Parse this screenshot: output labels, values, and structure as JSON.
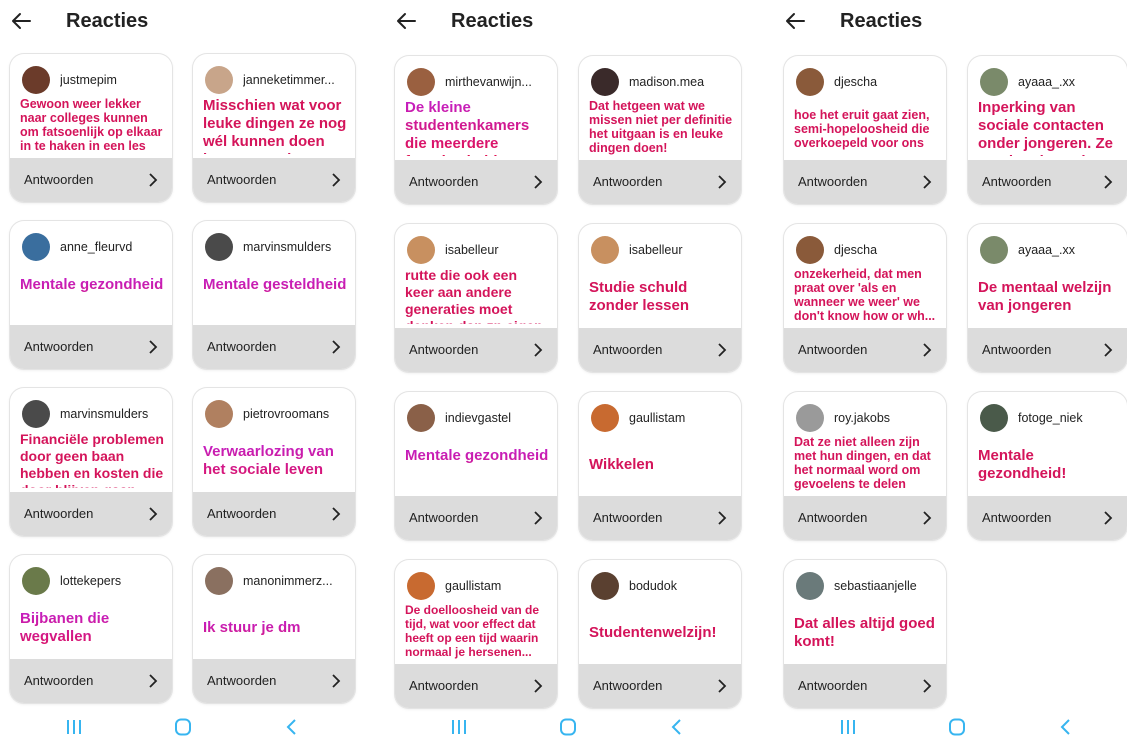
{
  "colors": {
    "accent": "#d4145a",
    "accent_magenta": "#c320c8",
    "nav": "#37b5f0",
    "reply_bg": "#dcdcdc"
  },
  "reply_label": "Antwoorden",
  "panels": [
    {
      "title": "Reacties",
      "cards": [
        {
          "user": "justmepim",
          "text": "Gewoon weer lekker naar colleges kunnen om fatsoenlijk op elkaar in te haken in een les",
          "avatar": "#6b3b2a"
        },
        {
          "user": "janneketimmer...",
          "text": "Misschien wat voor leuke dingen ze nog wél kunnen doen ipv wat ze niet meer kunnen",
          "avatar": "#c8a58a"
        },
        {
          "user": "anne_fleurvd",
          "text": "Mentale gezondheid",
          "avatar": "#3a6e9e"
        },
        {
          "user": "marvinsmulders",
          "text": "Mentale gesteldheid",
          "avatar": "#4a4a4a"
        },
        {
          "user": "marvinsmulders",
          "text": "Financiële problemen door geen baan hebben en kosten die door blijven gaan",
          "avatar": "#4a4a4a"
        },
        {
          "user": "pietrovroomans",
          "text": "Verwaarlozing van het sociale leven",
          "avatar": "#b08060"
        },
        {
          "user": "lottekepers",
          "text": "Bijbanen die wegvallen",
          "avatar": "#6a7a4a"
        },
        {
          "user": "manonimmerz...",
          "text": "Ik stuur je dm",
          "avatar": "#8a7060"
        }
      ]
    },
    {
      "title": "Reacties",
      "cards": [
        {
          "user": "mirthevanwijn...",
          "text": "De kleine studentenkamers die meerdere functies hebben",
          "avatar": "#9a6040"
        },
        {
          "user": "madison.mea",
          "text": "Dat hetgeen wat we missen niet per definitie het uitgaan is en leuke dingen doen!",
          "avatar": "#3a2a2a"
        },
        {
          "user": "isabelleur",
          "text": "rutte die ook een keer aan andere generaties moet denken dan zn eigen",
          "avatar": "#c89060"
        },
        {
          "user": "isabelleur",
          "text": "Studie schuld zonder lessen",
          "avatar": "#c89060"
        },
        {
          "user": "indievgastel",
          "text": "Mentale gezondheid",
          "avatar": "#8a6048"
        },
        {
          "user": "gaullistam",
          "text": "Wikkelen",
          "avatar": "#c86a30"
        },
        {
          "user": "gaullistam",
          "text": "De doelloosheid van de tijd, wat voor effect dat heeft op een tijd waarin normaal je hersenen...",
          "avatar": "#c86a30"
        },
        {
          "user": "bodudok",
          "text": "Studentenwelzijn!",
          "avatar": "#5a4030"
        }
      ]
    },
    {
      "title": "Reacties",
      "cards": [
        {
          "user": "djescha",
          "text": "hoe het eruit gaat zien, semi-hopeloosheid die overkoepeld voor ons",
          "avatar": "#8a5a3a"
        },
        {
          "user": "ayaaa_.xx",
          "text": "Inperking van sociale contacten onder jongeren. Ze zouden dat wel doen",
          "avatar": "#7a8a6a"
        },
        {
          "user": "djescha",
          "text": "onzekerheid, dat men praat over 'als en wanneer we weer' we don't know how or wh...",
          "avatar": "#8a5a3a"
        },
        {
          "user": "ayaaa_.xx",
          "text": "De mentaal welzijn van jongeren",
          "avatar": "#7a8a6a"
        },
        {
          "user": "roy.jakobs",
          "text": "Dat ze niet alleen zijn met hun dingen, en dat het normaal word om gevoelens te delen",
          "avatar": "#9a9a9a"
        },
        {
          "user": "fotoge_niek",
          "text": "Mentale gezondheid!",
          "avatar": "#4a5a4a"
        },
        {
          "user": "sebastiaanjelle",
          "text": "Dat alles altijd goed komt!",
          "avatar": "#6a7a7a"
        }
      ]
    }
  ]
}
